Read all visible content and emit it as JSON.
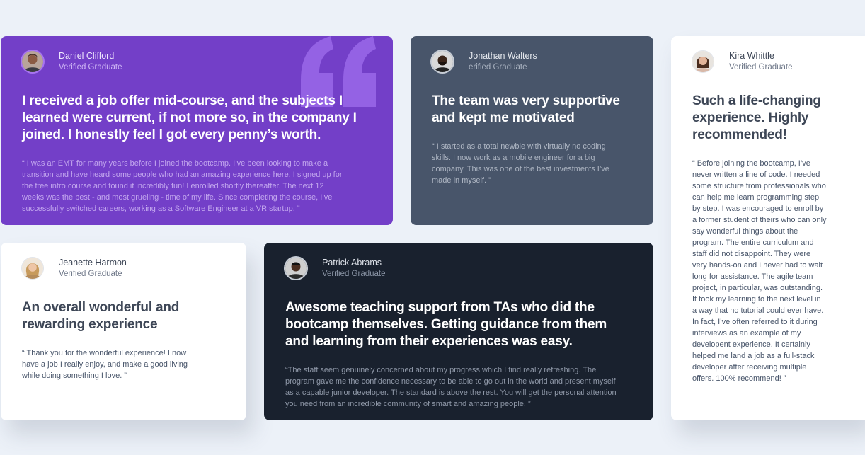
{
  "testimonials": [
    {
      "name": "Daniel Clifford",
      "role": "Verified Graduate",
      "title": "I received a job offer mid-course, and the subjects I learned were current, if not more so, in the company I joined. I honestly feel I got every penny’s worth.",
      "body": "“ I was an EMT for many years before I joined the bootcamp. I’ve been looking to make a transition and have heard some people who had an amazing experience here. I signed up for the free intro course and found it incredibly fun! I enrolled shortly thereafter. The next 12 weeks was the best - and most grueling - time of my life. Since completing the course, I’ve successfully switched careers, working as a Software Engineer at a VR startup. ”",
      "background": "#733fc8"
    },
    {
      "name": "Jonathan Walters",
      "role": "erified Graduate",
      "title": "The team was very supportive and kept me motivated",
      "body": "“ I started as a total newbie with virtually no coding skills. I now work as a mobile engineer for a big company. This was one of the best investments I’ve made in myself. ”",
      "background": "#48556a"
    },
    {
      "name": "Kira Whittle",
      "role": "Verified Graduate",
      "title": "Such a life-changing experience. Highly recommended!",
      "body": "“ Before joining the bootcamp, I’ve never written a line of code. I needed some structure from professionals who can help me learn programming step by step. I was encouraged to enroll by a former student of theirs who can only say wonderful things about the program. The entire curriculum and staff did not disappoint. They were very hands-on and I never had to wait long for assistance. The agile team project, in particular, was outstanding. It took my learning to the next level in a way that no tutorial could ever have. In fact, I’ve often referred to it during interviews as an example of my developent experience. It certainly helped me land a job as a full-stack developer after receiving multiple offers. 100% recommend! ”",
      "background": "#ffffff"
    },
    {
      "name": "Jeanette Harmon",
      "role": "Verified Graduate",
      "title": "An overall wonderful and rewarding experience",
      "body": "“ Thank you for the wonderful experience! I now have a job I really enjoy, and make a good living while doing something I love. ”",
      "background": "#ffffff"
    },
    {
      "name": "Patrick Abrams",
      "role": "Verified Graduate",
      "title": "Awesome teaching support from TAs who did the bootcamp themselves. Getting guidance from them and learning from their experiences was easy.",
      "body": "“The staff seem genuinely concerned about my progress which I find really refreshing. The program gave me the confidence necessary to be able to go out in the world and present myself as a capable junior developer. The standard is above the rest. You will get the personal attention you need from an incredible community of smart and amazing people. ”",
      "background": "#19212e"
    }
  ],
  "icons": {
    "avatar": "avatar-photo",
    "quote": "quotation-mark-icon"
  },
  "colors": {
    "page_background": "#ecf1f8",
    "accent_purple": "#733fc8",
    "quote_mark": "#9462e4"
  }
}
